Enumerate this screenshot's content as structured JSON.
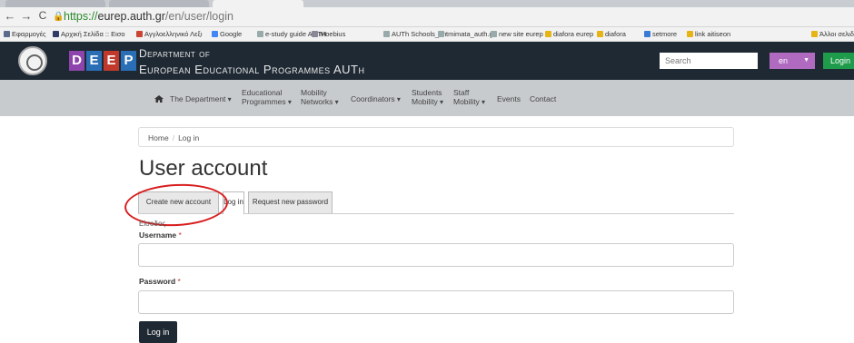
{
  "browser": {
    "url_https": "https://",
    "url_host": "eurep.auth.gr",
    "url_path": "/en/user/login",
    "bookmarks": [
      {
        "label": "Εφαρμογές",
        "color": "#5b6b8a"
      },
      {
        "label": "Αρχική Σελίδα :: Εισο",
        "color": "#2f3d66"
      },
      {
        "label": "Αγγλοελληνικό Λεξι",
        "color": "#c43"
      },
      {
        "label": "Google",
        "color": "#4285f4"
      },
      {
        "label": "e-study guide AUTH",
        "color": "#9aa"
      },
      {
        "label": "Moebius",
        "color": "#889"
      },
      {
        "label": "AUTh Schools_en",
        "color": "#9aa"
      },
      {
        "label": "tmimata_auth.gr",
        "color": "#9aa"
      },
      {
        "label": "new site eurep",
        "color": "#9aa"
      },
      {
        "label": "diafora eurep",
        "color": "#e7b416"
      },
      {
        "label": "diafora",
        "color": "#e7b416"
      },
      {
        "label": "setmore",
        "color": "#3a7bd5"
      },
      {
        "label": "link aitiseon",
        "color": "#e7b416"
      },
      {
        "label": "Άλλοι σελιδ",
        "color": "#e7b416"
      }
    ]
  },
  "header": {
    "logo_letters": [
      "D",
      "E",
      "E",
      "P"
    ],
    "logo_colors": [
      "#8e44ad",
      "#2a6fb5",
      "#c0392b",
      "#2a6fb5"
    ],
    "dept_line1": "Department of",
    "dept_line2": "European Educational Programmes AUTh",
    "search_placeholder": "Search",
    "lang": "en",
    "login_label": "Login"
  },
  "nav": {
    "items": [
      {
        "l1": "The Department",
        "l2": "",
        "caret": true
      },
      {
        "l1": "Educational",
        "l2": "Programmes",
        "caret": true
      },
      {
        "l1": "Mobility",
        "l2": "Networks",
        "caret": true
      },
      {
        "l1": "Coordinators",
        "l2": "",
        "caret": true
      },
      {
        "l1": "Students",
        "l2": "Mobility",
        "caret": true
      },
      {
        "l1": "Staff",
        "l2": "Mobility",
        "caret": true
      },
      {
        "l1": "Events",
        "l2": "",
        "caret": false
      },
      {
        "l1": "Contact",
        "l2": "",
        "caret": false
      }
    ]
  },
  "breadcrumb": {
    "home": "Home",
    "current": "Log in"
  },
  "page_title": "User account",
  "tabs": [
    "Create new account",
    "Log in",
    "Request new password"
  ],
  "form": {
    "greek_label": "Είσοδος",
    "username_label": "Username",
    "password_label": "Password",
    "required_mark": "*",
    "submit": "Log in"
  }
}
